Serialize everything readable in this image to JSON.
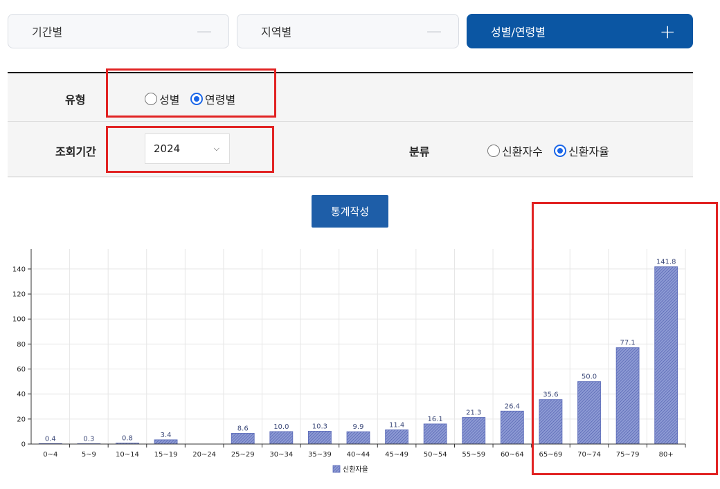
{
  "tabs": [
    {
      "label": "기간별",
      "sign": "—",
      "active": false
    },
    {
      "label": "지역별",
      "sign": "—",
      "active": false
    },
    {
      "label": "성별/연령별",
      "sign": "+",
      "active": true
    }
  ],
  "form": {
    "type_label": "유형",
    "type_options": [
      {
        "label": "성별",
        "checked": false
      },
      {
        "label": "연령별",
        "checked": true
      }
    ],
    "period_label": "조회기간",
    "period_value": "2024",
    "category_label": "분류",
    "category_options": [
      {
        "label": "신환자수",
        "checked": false
      },
      {
        "label": "신환자율",
        "checked": true
      }
    ]
  },
  "generate_button": "통계작성",
  "colors": {
    "accent": "#0b56a3",
    "button": "#1e5ea8",
    "bar": "#6b7cc4",
    "highlight": "#e12323"
  },
  "chart_data": {
    "type": "bar",
    "categories": [
      "0~4",
      "5~9",
      "10~14",
      "15~19",
      "20~24",
      "25~29",
      "30~34",
      "35~39",
      "40~44",
      "45~49",
      "50~54",
      "55~59",
      "60~64",
      "65~69",
      "70~74",
      "75~79",
      "80+"
    ],
    "series": [
      {
        "name": "신환자율",
        "values": [
          0.4,
          0.3,
          0.8,
          3.4,
          null,
          8.6,
          10.0,
          10.3,
          9.9,
          11.4,
          16.1,
          21.3,
          26.4,
          35.6,
          50.0,
          77.1,
          141.8
        ]
      }
    ],
    "value_labels": [
      "0.4",
      "0.3",
      "0.8",
      "3.4",
      "",
      "8.6",
      "10.0",
      "10.3",
      "9.9",
      "11.4",
      "16.1",
      "21.3",
      "26.4",
      "35.6",
      "50.0",
      "77.1",
      "141.8"
    ],
    "yticks": [
      0,
      20,
      40,
      60,
      80,
      100,
      120,
      140
    ],
    "ylim": [
      0,
      156
    ],
    "grid": true,
    "legend": "bottom-center"
  }
}
